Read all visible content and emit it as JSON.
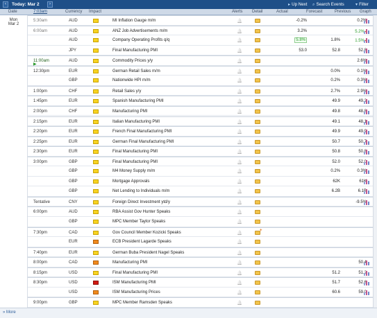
{
  "topbar": {
    "prev_icon": "chevron-left-icon",
    "today_label": "Today: Mar 2",
    "next_icon": "chevron-right-icon",
    "up_next": "Up Next",
    "search_events": "Search Events",
    "filter": "Filter"
  },
  "columns": {
    "date": "Date",
    "time": "7:03am",
    "currency": "Currency",
    "impact": "Impact",
    "alerts": "Alerts",
    "detail": "Detail",
    "actual": "Actual",
    "forecast": "Forecast",
    "previous": "Previous",
    "graph": "Graph"
  },
  "date": {
    "day": "Mon",
    "date": "Mar 2"
  },
  "colors": {
    "accent": "#1e4f88",
    "better": "#2a9a2a",
    "low_impact": "#f7d321",
    "medium_impact": "#f08a1d",
    "high_impact": "#d11a12"
  },
  "rows": [
    {
      "time": "5:30am",
      "currency": "AUD",
      "impact": "low",
      "event": "MI Inflation Gauge m/m",
      "actual": "-0.2%",
      "forecast": "",
      "previous": "0.2%",
      "graph": true,
      "state": "past"
    },
    {
      "time": "6:00am",
      "currency": "AUD",
      "impact": "low",
      "event": "ANZ Job Advertisements m/m",
      "actual": "3.2%",
      "forecast": "",
      "previous": "5.2%",
      "graph": true,
      "state": "past",
      "prev_better": true,
      "prev_revised": true
    },
    {
      "time": "",
      "currency": "AUD",
      "impact": "low",
      "event": "Company Operating Profits q/q",
      "actual": "5.8%",
      "forecast": "1.8%",
      "previous": "1.5%",
      "graph": true,
      "actual_better": true,
      "prev_better": true,
      "prev_revised": true
    },
    {
      "time": "",
      "currency": "JPY",
      "impact": "low",
      "event": "Final Manufacturing PMI",
      "actual": "53.0",
      "forecast": "52.8",
      "previous": "52.8",
      "graph": true
    },
    {
      "time": "11:00am",
      "currency": "AUD",
      "impact": "low",
      "event": "Commodity Prices y/y",
      "actual": "",
      "forecast": "",
      "previous": "2.6%",
      "graph": true,
      "state": "current"
    },
    {
      "time": "12:30pm",
      "currency": "EUR",
      "impact": "low",
      "event": "German Retail Sales m/m",
      "actual": "",
      "forecast": "0.0%",
      "previous": "0.1%",
      "graph": true
    },
    {
      "time": "",
      "currency": "GBP",
      "impact": "low",
      "event": "Nationwide HPI m/m",
      "actual": "",
      "forecast": "0.2%",
      "previous": "0.3%",
      "graph": true
    },
    {
      "time": "1:00pm",
      "currency": "CHF",
      "impact": "low",
      "event": "Retail Sales y/y",
      "actual": "",
      "forecast": "2.7%",
      "previous": "2.9%",
      "graph": true
    },
    {
      "time": "1:45pm",
      "currency": "EUR",
      "impact": "low",
      "event": "Spanish Manufacturing PMI",
      "actual": "",
      "forecast": "49.9",
      "previous": "49.2",
      "graph": true
    },
    {
      "time": "2:00pm",
      "currency": "CHF",
      "impact": "low",
      "event": "Manufacturing PMI",
      "actual": "",
      "forecast": "49.8",
      "previous": "48.8",
      "graph": true
    },
    {
      "time": "2:15pm",
      "currency": "EUR",
      "impact": "low",
      "event": "Italian Manufacturing PMI",
      "actual": "",
      "forecast": "49.1",
      "previous": "48.1",
      "graph": true
    },
    {
      "time": "2:20pm",
      "currency": "EUR",
      "impact": "low",
      "event": "French Final Manufacturing PMI",
      "actual": "",
      "forecast": "49.9",
      "previous": "49.9",
      "graph": true
    },
    {
      "time": "2:25pm",
      "currency": "EUR",
      "impact": "low",
      "event": "German Final Manufacturing PMI",
      "actual": "",
      "forecast": "50.7",
      "previous": "50.7",
      "graph": true
    },
    {
      "time": "2:30pm",
      "currency": "EUR",
      "impact": "low",
      "event": "Final Manufacturing PMI",
      "actual": "",
      "forecast": "50.8",
      "previous": "50.8",
      "graph": true
    },
    {
      "time": "3:00pm",
      "currency": "GBP",
      "impact": "low",
      "event": "Final Manufacturing PMI",
      "actual": "",
      "forecast": "52.0",
      "previous": "52.0",
      "graph": true
    },
    {
      "time": "",
      "currency": "GBP",
      "impact": "low",
      "event": "M4 Money Supply m/m",
      "actual": "",
      "forecast": "0.2%",
      "previous": "0.3%",
      "graph": true
    },
    {
      "time": "",
      "currency": "GBP",
      "impact": "low",
      "event": "Mortgage Approvals",
      "actual": "",
      "forecast": "62K",
      "previous": "61K",
      "graph": true
    },
    {
      "time": "",
      "currency": "GBP",
      "impact": "low",
      "event": "Net Lending to Individuals m/m",
      "actual": "",
      "forecast": "6.2B",
      "previous": "6.1B",
      "graph": true
    },
    {
      "time": "Tentative",
      "currency": "CNY",
      "impact": "low",
      "event": "Foreign Direct Investment ytd/y",
      "actual": "",
      "forecast": "",
      "previous": "-9.5%",
      "graph": true
    },
    {
      "time": "6:00pm",
      "currency": "AUD",
      "impact": "low",
      "event": "RBA Assist Gov Hunter Speaks",
      "actual": "",
      "forecast": "",
      "previous": "",
      "graph": false
    },
    {
      "time": "",
      "currency": "GBP",
      "impact": "low",
      "event": "MPC Member Taylor Speaks",
      "actual": "",
      "forecast": "",
      "previous": "",
      "graph": false
    },
    {
      "time": "7:30pm",
      "currency": "CAD",
      "impact": "low",
      "event": "Gov Council Member Kozicki Speaks",
      "actual": "",
      "forecast": "",
      "previous": "",
      "graph": false,
      "detail_new": true
    },
    {
      "time": "",
      "currency": "EUR",
      "impact": "medium",
      "event": "ECB President Lagarde Speaks",
      "actual": "",
      "forecast": "",
      "previous": "",
      "graph": false
    },
    {
      "time": "7:40pm",
      "currency": "EUR",
      "impact": "low",
      "event": "German Buba President Nagel Speaks",
      "actual": "",
      "forecast": "",
      "previous": "",
      "graph": false
    },
    {
      "time": "8:00pm",
      "currency": "CAD",
      "impact": "medium",
      "event": "Manufacturing PMI",
      "actual": "",
      "forecast": "",
      "previous": "50.4",
      "graph": true
    },
    {
      "time": "8:15pm",
      "currency": "USD",
      "impact": "low",
      "event": "Final Manufacturing PMI",
      "actual": "",
      "forecast": "51.2",
      "previous": "51.2",
      "graph": true
    },
    {
      "time": "8:30pm",
      "currency": "USD",
      "impact": "high",
      "event": "ISM Manufacturing PMI",
      "actual": "",
      "forecast": "51.7",
      "previous": "52.6",
      "graph": true
    },
    {
      "time": "",
      "currency": "USD",
      "impact": "medium",
      "event": "ISM Manufacturing Prices",
      "actual": "",
      "forecast": "60.6",
      "previous": "59.0",
      "graph": true
    },
    {
      "time": "9:00pm",
      "currency": "GBP",
      "impact": "low",
      "event": "MPC Member Ramsden Speaks",
      "actual": "",
      "forecast": "",
      "previous": "",
      "graph": false
    }
  ],
  "footer": {
    "more": "More"
  }
}
